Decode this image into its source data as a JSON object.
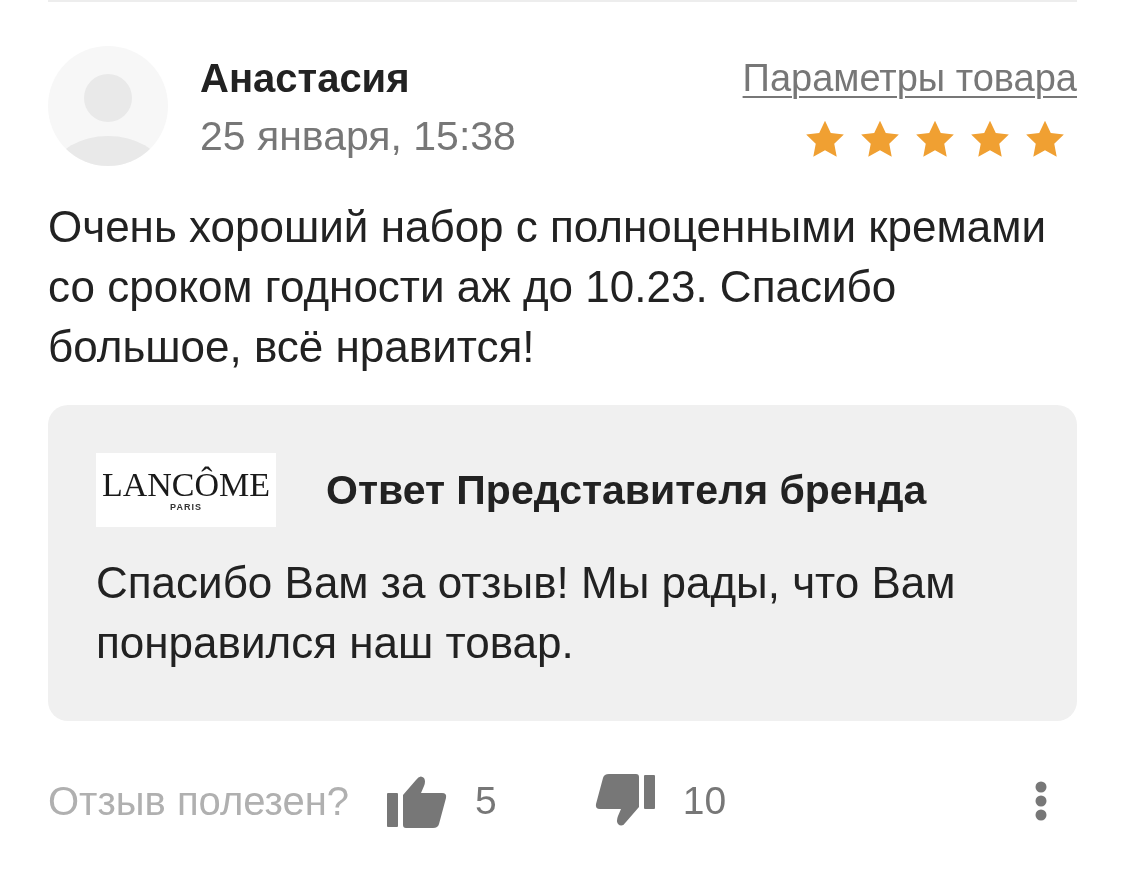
{
  "review": {
    "author": "Анастасия",
    "date": "25 января, 15:38",
    "params_link": "Параметры товара",
    "stars": 5,
    "text": "Очень хороший набор с полноценными кремами со сроком годности аж до 10.23. Спасибо большое, всё нравится!"
  },
  "brand_reply": {
    "logo": {
      "wordmark": "LANCÔME",
      "subtitle": "PARIS"
    },
    "title": "Ответ Представителя бренда",
    "text": "Спасибо Вам за отзыв! Мы рады, что Вам понравился наш товар."
  },
  "footer": {
    "helpful_label": "Отзыв полезен?",
    "likes": "5",
    "dislikes": "10"
  }
}
